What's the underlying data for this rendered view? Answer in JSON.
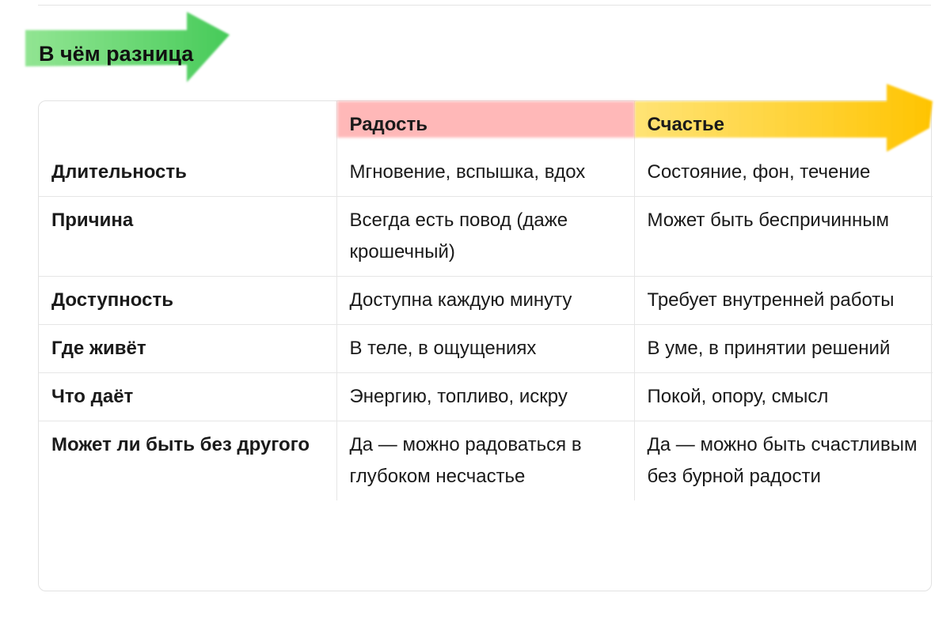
{
  "heading": {
    "title": "В чём разница",
    "highlight_color": "#4cd157"
  },
  "table": {
    "columns": [
      "",
      "Радость",
      "Счастье"
    ],
    "column_colors": {
      "joy": "#ff9a9a",
      "happiness": "#ffc800"
    },
    "rows": [
      {
        "label": "Длительность",
        "joy": "Мгновение, вспышка, вдох",
        "happiness": "Состояние, фон, течение"
      },
      {
        "label": "Причина",
        "joy": "Всегда есть повод (даже крошечный)",
        "happiness": "Может быть беспричинным"
      },
      {
        "label": "Доступность",
        "joy": "Доступна каждую минуту",
        "happiness": "Требует внутренней работы"
      },
      {
        "label": "Где живёт",
        "joy": "В теле, в ощущениях",
        "happiness": "В уме, в принятии решений"
      },
      {
        "label": "Что даёт",
        "joy": "Энергию, топливо, искру",
        "happiness": "Покой, опору, смысл"
      },
      {
        "label": "Может ли быть без другого",
        "joy": "Да — можно радоваться в глубоком несчастье",
        "happiness": "Да — можно быть счастливым без бурной радости"
      }
    ]
  }
}
